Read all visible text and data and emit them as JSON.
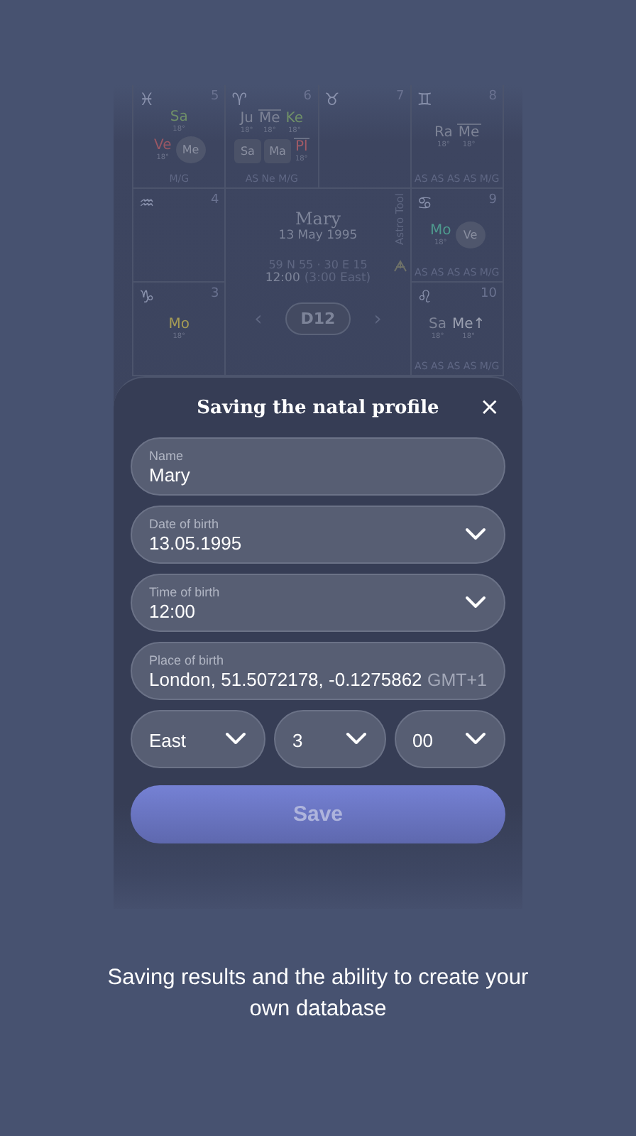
{
  "chart": {
    "cells": [
      {
        "sign": "♓",
        "number": "5",
        "rows": [
          [
            {
              "name": "Sa",
              "color": "#6f8f68",
              "deg": "18°",
              "kind": "plain"
            }
          ],
          [
            {
              "name": "Ve",
              "color": "#9a5764",
              "deg": "18°",
              "kind": "plain"
            },
            {
              "name": "Me",
              "color": "#8a8fa0",
              "kind": "circled"
            }
          ]
        ],
        "footer": "M/G"
      },
      {
        "sign": "♈",
        "number": "6",
        "rows": [
          [
            {
              "name": "Ju",
              "color": "#7d8396",
              "deg": "18°",
              "kind": "plain"
            },
            {
              "name": "Me",
              "color": "#7d8396",
              "deg": "18°",
              "kind": "overlined"
            },
            {
              "name": "Ke",
              "color": "#6f8f68",
              "deg": "18°",
              "kind": "plain"
            }
          ],
          [
            {
              "name": "Sa",
              "color": "#8a8fa0",
              "kind": "boxed"
            },
            {
              "name": "Ma",
              "color": "#8a8fa0",
              "kind": "boxed"
            },
            {
              "name": "Pl",
              "color": "#a05a66",
              "deg": "18°",
              "kind": "overlined"
            }
          ]
        ],
        "footer": "AS Ne M/G"
      },
      {
        "sign": "♉",
        "number": "7"
      },
      {
        "sign": "♊",
        "number": "8",
        "rows": [
          [
            {
              "name": "Ra",
              "color": "#7d8396",
              "deg": "18°",
              "kind": "plain"
            },
            {
              "name": "Me",
              "color": "#7d8396",
              "deg": "18°",
              "kind": "overlined"
            }
          ]
        ],
        "footer": "AS AS AS AS M/G"
      },
      {
        "sign": "♒",
        "number": "4"
      },
      {
        "sign": "♋",
        "number": "9",
        "rows": [
          [
            {
              "name": "Mo",
              "color": "#4e9a8e",
              "deg": "18°",
              "kind": "plain"
            },
            {
              "name": "Ve",
              "color": "#8a8fa0",
              "kind": "circled"
            }
          ]
        ],
        "footer": "AS AS AS AS M/G"
      },
      {
        "sign": "♑",
        "number": "3",
        "rows": [
          [
            {
              "name": "Mo",
              "color": "#a49a55",
              "deg": "18°",
              "kind": "plain"
            }
          ]
        ]
      },
      {
        "sign": "♌",
        "number": "10",
        "rows": [
          [
            {
              "name": "Sa",
              "color": "#7d8396",
              "deg": "18°",
              "kind": "plain"
            },
            {
              "name": "Me↑",
              "color": "#9ba0b0",
              "deg": "18°",
              "kind": "plain"
            }
          ]
        ],
        "footer": "AS AS AS AS M/G"
      }
    ],
    "center": {
      "name": "Mary",
      "date": "13 May 1995",
      "coords": "59 N 55 · 30 E 15",
      "time": "12:00",
      "zone": "(3:00 East)",
      "prev": "‹",
      "division": "D12",
      "next": "›",
      "brand": "Astro Tool"
    }
  },
  "sheet": {
    "title": "Saving the natal profile",
    "close": "×",
    "fields": [
      {
        "kind": "text",
        "label": "Name",
        "value": "Mary"
      },
      {
        "kind": "select",
        "label": "Date of birth",
        "value": "13.05.1995"
      },
      {
        "kind": "select",
        "label": "Time of birth",
        "value": "12:00"
      },
      {
        "kind": "place",
        "label": "Place of birth",
        "value": "London, 51.5072178, -0.1275862",
        "suffix": "GMT+1"
      }
    ],
    "timezone": [
      {
        "value": "East"
      },
      {
        "value": "3"
      },
      {
        "value": "00"
      }
    ],
    "save": "Save"
  },
  "caption": "Saving results and the ability to create your own database"
}
